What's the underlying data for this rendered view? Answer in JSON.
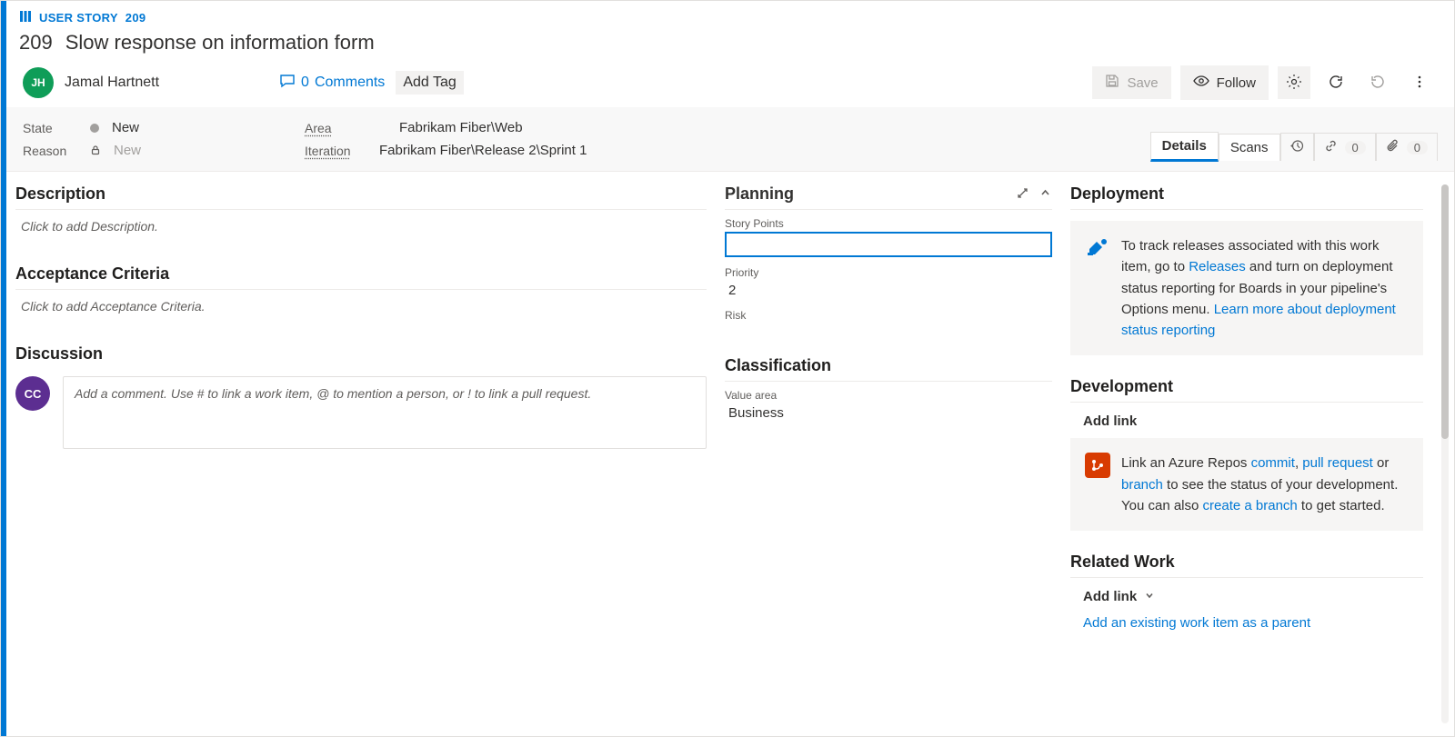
{
  "breadcrumb": {
    "type": "USER STORY",
    "id": "209"
  },
  "work_item": {
    "id": "209",
    "title": "Slow response on information form"
  },
  "assignee": {
    "initials": "JH",
    "name": "Jamal Hartnett"
  },
  "comments": {
    "count": "0",
    "label": "Comments"
  },
  "add_tag": "Add Tag",
  "toolbar": {
    "save": "Save",
    "follow": "Follow"
  },
  "fields": {
    "state": {
      "label": "State",
      "value": "New"
    },
    "reason": {
      "label": "Reason",
      "value": "New"
    },
    "area": {
      "label": "Area",
      "value": "Fabrikam Fiber\\Web"
    },
    "iteration": {
      "label": "Iteration",
      "value": "Fabrikam Fiber\\Release 2\\Sprint 1"
    }
  },
  "tabs": {
    "details": "Details",
    "scans": "Scans",
    "links_count": "0",
    "attach_count": "0"
  },
  "left": {
    "description": {
      "title": "Description",
      "placeholder": "Click to add Description."
    },
    "acceptance": {
      "title": "Acceptance Criteria",
      "placeholder": "Click to add Acceptance Criteria."
    },
    "discussion": {
      "title": "Discussion",
      "avatar": "CC",
      "placeholder": "Add a comment. Use # to link a work item, @ to mention a person, or ! to link a pull request."
    }
  },
  "mid": {
    "planning": {
      "title": "Planning",
      "story_points": "Story Points",
      "priority_label": "Priority",
      "priority_value": "2",
      "risk_label": "Risk"
    },
    "classification": {
      "title": "Classification",
      "value_area_label": "Value area",
      "value_area_value": "Business"
    }
  },
  "right": {
    "deployment": {
      "title": "Deployment",
      "text1": "To track releases associated with this work item, go to ",
      "link1": "Releases",
      "text2": " and turn on deployment status reporting for Boards in your pipeline's Options menu. ",
      "link2": "Learn more about deployment status reporting"
    },
    "development": {
      "title": "Development",
      "add_link": "Add link",
      "text1": "Link an Azure Repos ",
      "link_commit": "commit",
      "link_pr": "pull request",
      "link_branch": "branch",
      "text2": " to see the status of your development. You can also ",
      "link_create": "create a branch",
      "text3": " to get started.",
      "sep": ", ",
      "or": " or "
    },
    "related": {
      "title": "Related Work",
      "add_link": "Add link",
      "existing": "Add an existing work item as a parent"
    }
  }
}
